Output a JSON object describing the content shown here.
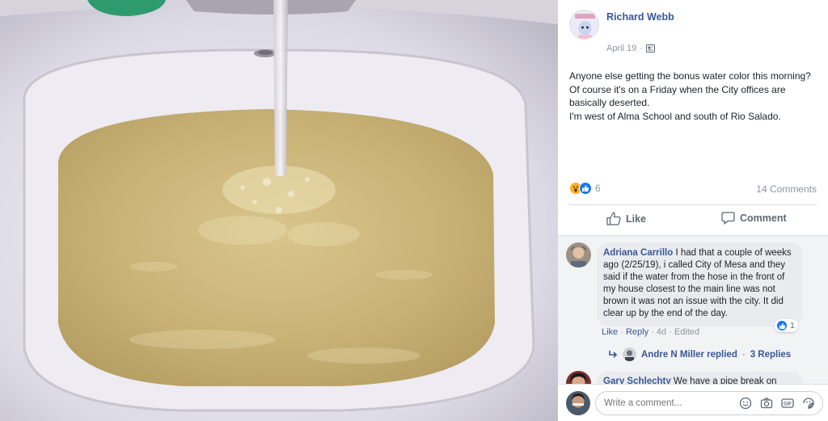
{
  "post": {
    "author": "Richard Webb",
    "date": "April 19",
    "date_separator": "·",
    "body_line_1": "Anyone else getting the bonus water color this morning? Of course it's on a Friday when the City offices are basically deserted.",
    "body_line_2": "I'm west of Alma School and south of Rio Salado.",
    "reaction_count": "6",
    "comments_count": "14 Comments",
    "reaction_icons": [
      "wow-icon",
      "like-icon"
    ]
  },
  "actions": {
    "like_label": "Like",
    "comment_label": "Comment"
  },
  "comments": [
    {
      "author": "Adriana Carrillo",
      "text": " I had that a couple of weeks ago (2/25/19), i called City of Mesa and they said if the water from the hose in the front of my house closest to the main line was not brown it was not an issue with the city. It did clear up by the end of the day.",
      "like_count": "1",
      "like_link": "Like",
      "reply_link": "Reply",
      "age": "4d",
      "edited": "Edited",
      "replier": "Andre N Miller replied",
      "replies_sep": "·",
      "replies": "3 Replies"
    },
    {
      "author": "Gary Schlechty",
      "text": " We have a pipe break on"
    }
  ],
  "composer": {
    "placeholder": "Write a comment..."
  },
  "colors": {
    "link_blue": "#385898",
    "water": "#cbb57a",
    "sink": "#e9e7ee"
  }
}
